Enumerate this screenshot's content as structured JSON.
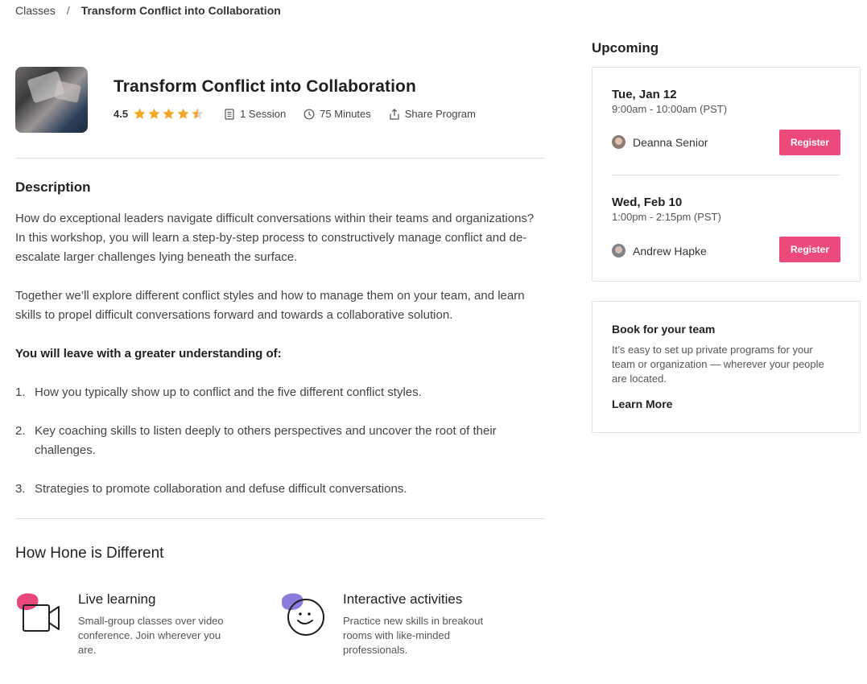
{
  "breadcrumb": {
    "classes_label": "Classes",
    "separator": "/",
    "current": "Transform Conflict into Collaboration"
  },
  "program": {
    "title": "Transform Conflict into Collaboration",
    "rating": "4.5",
    "rating_value": 4.5,
    "rating_max": 5,
    "sessions": "1 Session",
    "duration": "75 Minutes",
    "share_label": "Share Program",
    "star_color": "#f5a623"
  },
  "description": {
    "title": "Description",
    "paragraph1": "How do exceptional leaders navigate difficult conversations within their teams and organizations? In this workshop, you will learn a step-by-step process to constructively manage conflict and de-escalate larger challenges lying beneath the surface.",
    "paragraph2": "Together we’ll explore different conflict styles and how to manage them on your team, and learn skills to propel difficult conversations forward and towards a collaborative solution.",
    "lead": "You will leave with a greater understanding of:",
    "items": [
      {
        "num": "1.",
        "text": "How you typically show up to conflict and the five different conflict styles."
      },
      {
        "num": "2.",
        "text": "Key coaching skills to listen deeply to others perspectives and uncover the root of their challenges."
      },
      {
        "num": "3.",
        "text": "Strategies to promote collaboration and defuse difficult conversations."
      }
    ]
  },
  "how": {
    "title": "How Hone is Different",
    "features": [
      {
        "title": "Live learning",
        "desc": "Small-group classes over video conference. Join wherever you are.",
        "icon": "video-camera-icon",
        "accent": "#e8477a"
      },
      {
        "title": "Interactive activities",
        "desc": "Practice new skills in breakout rooms with like-minded professionals.",
        "icon": "smiley-face-icon",
        "accent": "#8a7bdc"
      }
    ]
  },
  "upcoming": {
    "title": "Upcoming",
    "sessions": [
      {
        "date": "Tue, Jan 12",
        "time": "9:00am - 10:00am (PST)",
        "instructor": "Deanna Senior",
        "register_label": "Register"
      },
      {
        "date": "Wed, Feb 10",
        "time": "1:00pm - 2:15pm (PST)",
        "instructor": "Andrew Hapke",
        "register_label": "Register"
      }
    ],
    "accent": "#ec4a7a"
  },
  "book": {
    "title": "Book for your team",
    "desc": "It’s easy to set up private programs for your team or organization — wherever your people are located.",
    "link": "Learn More"
  }
}
